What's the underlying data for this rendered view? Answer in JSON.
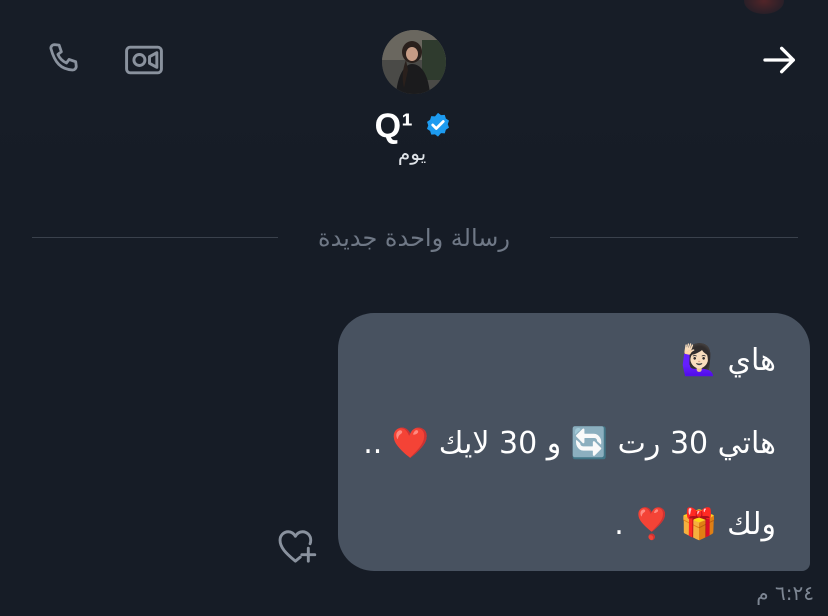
{
  "header": {
    "contact_name": "Q¹",
    "subtitle_fragment": "يوم"
  },
  "divider": {
    "label": "رسالة واحدة جديدة"
  },
  "message": {
    "lines": [
      "هاي 🙋🏻‍♀️",
      "هاتي 30 رت 🔄 و 30 لايك ❤️ ..",
      "ولك 🎁 ❣️ ."
    ],
    "time": "٦:٢٤ م"
  },
  "icons": {
    "call": "phone-icon",
    "video": "video-camera-icon",
    "back": "arrow-right-icon",
    "verified": "verified-badge-icon",
    "react": "heart-plus-icon"
  },
  "colors": {
    "background": "#161c26",
    "bubble": "#485260",
    "verified_blue": "#1d9bf0",
    "muted_text": "#6f7886"
  }
}
